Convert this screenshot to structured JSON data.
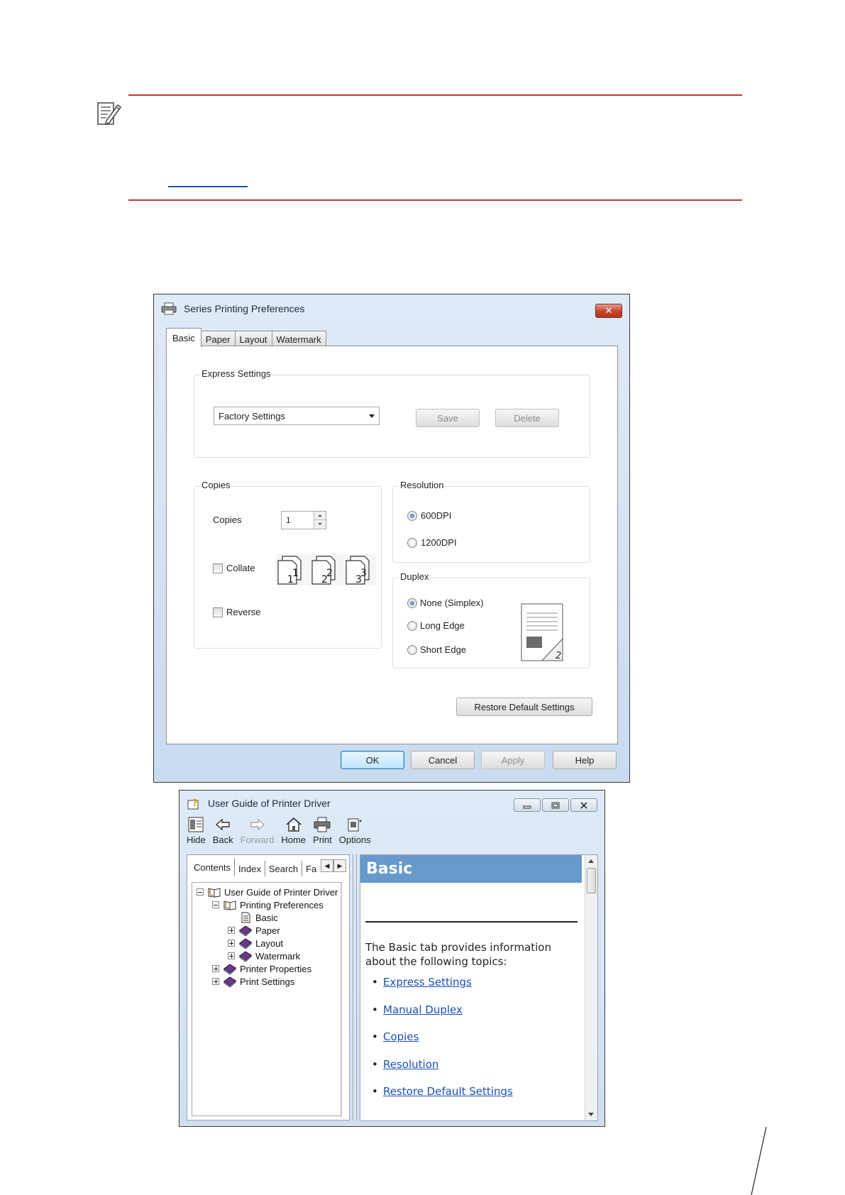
{
  "prefs_dialog": {
    "title": "Series Printing Preferences",
    "close_label": "✕",
    "tabs": [
      "Basic",
      "Paper",
      "Layout",
      "Watermark"
    ],
    "express_settings": {
      "group_label": "Express Settings",
      "dropdown_value": "Factory Settings",
      "save_label": "Save",
      "delete_label": "Delete"
    },
    "copies": {
      "group_label": "Copies",
      "copies_label": "Copies",
      "copies_value": "1",
      "collate_label": "Collate",
      "reverse_label": "Reverse",
      "collate_pages": [
        "1",
        "2",
        "3"
      ]
    },
    "resolution": {
      "group_label": "Resolution",
      "options": [
        "600DPI",
        "1200DPI"
      ],
      "selected": "600DPI"
    },
    "duplex": {
      "group_label": "Duplex",
      "options": [
        "None (Simplex)",
        "Long Edge",
        "Short Edge"
      ],
      "selected": "None (Simplex)",
      "preview_page": "2"
    },
    "restore_label": "Restore Default Settings",
    "ok_label": "OK",
    "cancel_label": "Cancel",
    "apply_label": "Apply",
    "help_label": "Help"
  },
  "help_viewer": {
    "title": "User Guide of Printer Driver",
    "toolbar": [
      {
        "label": "Hide",
        "icon": "hide-icon",
        "enabled": true
      },
      {
        "label": "Back",
        "icon": "back-arrow-icon",
        "enabled": true
      },
      {
        "label": "Forward",
        "icon": "forward-arrow-icon",
        "enabled": false
      },
      {
        "label": "Home",
        "icon": "home-icon",
        "enabled": true
      },
      {
        "label": "Print",
        "icon": "printer-icon",
        "enabled": true
      },
      {
        "label": "Options",
        "icon": "options-icon",
        "enabled": true
      }
    ],
    "nav_tabs": [
      "Contents",
      "Index",
      "Search",
      "Fa"
    ],
    "tree": [
      {
        "label": "User Guide of Printer Driver",
        "icon": "open-book-icon"
      },
      {
        "label": "Printing Preferences",
        "icon": "open-book-icon"
      },
      {
        "label": "Basic",
        "icon": "page-icon"
      },
      {
        "label": "Paper",
        "icon": "closed-book-icon"
      },
      {
        "label": "Layout",
        "icon": "closed-book-icon"
      },
      {
        "label": "Watermark",
        "icon": "closed-book-icon"
      },
      {
        "label": "Printer Properties",
        "icon": "closed-book-icon"
      },
      {
        "label": "Print Settings",
        "icon": "closed-book-icon"
      }
    ],
    "content": {
      "heading": "Basic",
      "intro": "The Basic tab provides information about the following topics:",
      "links": [
        "Express Settings",
        "Manual Duplex",
        "Copies",
        "Resolution",
        "Restore Default Settings"
      ]
    }
  },
  "colors": {
    "note_rule": "#c0392b",
    "link_blue": "#1a4fb5",
    "help_header": "#6699cc"
  }
}
